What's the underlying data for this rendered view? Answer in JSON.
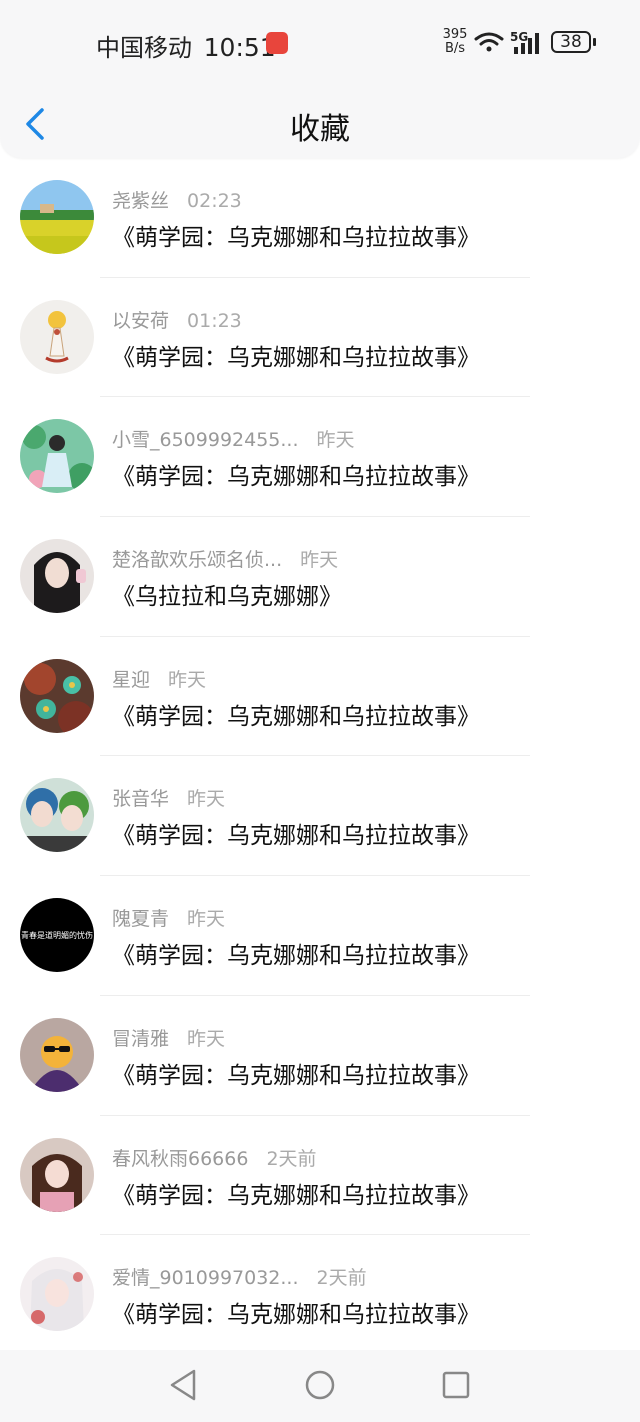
{
  "status_bar": {
    "carrier": "中国移动",
    "time": "10:51",
    "net_speed_value": "395",
    "net_speed_unit": "B/s",
    "network": "5G",
    "battery": "38"
  },
  "header": {
    "title": "收藏"
  },
  "favorites": [
    {
      "user": "尧紫丝",
      "time": "02:23",
      "title": "《萌学园：乌克娜娜和乌拉拉故事》",
      "avatar": "avatar-field"
    },
    {
      "user": "以安荷",
      "time": "01:23",
      "title": "《萌学园：乌克娜娜和乌拉拉故事》",
      "avatar": "avatar-flower-doll"
    },
    {
      "user": "小雪_6509992455...",
      "time": "昨天",
      "title": "《萌学园：乌克娜娜和乌拉拉故事》",
      "avatar": "avatar-lotus-girl"
    },
    {
      "user": "楚洛歆欢乐颂名侦...",
      "time": "昨天",
      "title": "《乌拉拉和乌克娜娜》",
      "avatar": "avatar-girl-portrait"
    },
    {
      "user": "星迎",
      "time": "昨天",
      "title": "《萌学园：乌克娜娜和乌拉拉故事》",
      "avatar": "avatar-green-flowers"
    },
    {
      "user": "张音华",
      "time": "昨天",
      "title": "《萌学园：乌克娜娜和乌拉拉故事》",
      "avatar": "avatar-couple"
    },
    {
      "user": "隗夏青",
      "time": "昨天",
      "title": "《萌学园：乌克娜娜和乌拉拉故事》",
      "avatar": "avatar-black-text",
      "avatar_text": "青春是道明媚的忧伤"
    },
    {
      "user": "冒清雅",
      "time": "昨天",
      "title": "《萌学园：乌克娜娜和乌拉拉故事》",
      "avatar": "avatar-emoji-sunglasses"
    },
    {
      "user": "春风秋雨66666",
      "time": "2天前",
      "title": "《萌学园：乌克娜娜和乌拉拉故事》",
      "avatar": "avatar-girl-pink"
    },
    {
      "user": "爱情_9010997032...",
      "time": "2天前",
      "title": "《萌学园：乌克娜娜和乌拉拉故事》",
      "avatar": "avatar-anime-girl"
    }
  ],
  "nav": {
    "back_icon": "triangle-back-icon",
    "home_icon": "circle-home-icon",
    "recents_icon": "square-recents-icon"
  },
  "colors": {
    "accent": "#1e88e5",
    "header_bg": "#f7f7f8",
    "muted_text": "#999999"
  }
}
